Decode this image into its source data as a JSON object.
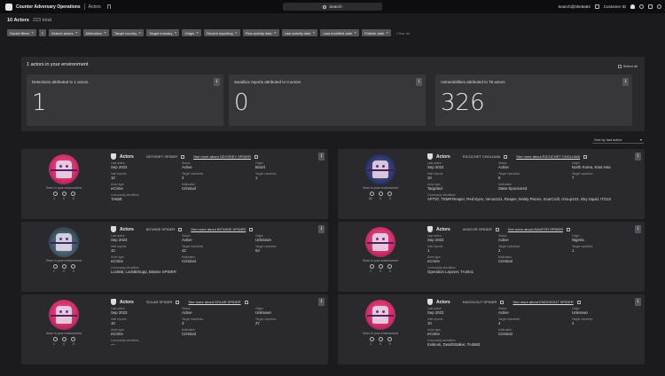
{
  "topbar": {
    "app_title": "Counter Adversary Operations",
    "breadcrumb": "Actors",
    "search_label": "Search",
    "user": "Search@00e9a84",
    "customer": "Customer ID"
  },
  "summary": {
    "count": "10 Actors",
    "total": "223 total"
  },
  "filters": [
    {
      "label": "Saved filters",
      "caret": true
    },
    {
      "label": "Search actors",
      "caret": true
    },
    {
      "label": "Motivation",
      "caret": true
    },
    {
      "label": "Target country",
      "caret": true
    },
    {
      "label": "Target industry",
      "caret": true
    },
    {
      "label": "Origin",
      "caret": true
    },
    {
      "label": "Recent reporting",
      "caret": true
    },
    {
      "label": "First activity date",
      "caret": true
    },
    {
      "label": "Last activity date",
      "caret": true
    },
    {
      "label": "Last modified date",
      "caret": true
    },
    {
      "label": "Publish date",
      "caret": true
    }
  ],
  "clear_all": "Clear all",
  "environment": {
    "title": "1 actors in your environment",
    "select_all": "Select all",
    "stats": [
      {
        "title": "Detections attributed to 1 actors",
        "value": "1"
      },
      {
        "title": "Sandbox reports attributed to 0 actors",
        "value": "0"
      },
      {
        "title": "Vulnerabilities attributed to 78 actors",
        "value": "326"
      }
    ]
  },
  "sort": {
    "label": "Sort by last active"
  },
  "labels": {
    "actors": "Actors",
    "seen": "Seen in your environment",
    "last_active": "Last active",
    "status": "Status",
    "origin": "Origin",
    "intel_reports": "Intel reports",
    "target_industries": "Target industries",
    "target_countries": "Target countries",
    "actor_type": "Actor type",
    "motivation": "Motivation",
    "community_identifiers": "Community identifiers"
  },
  "cards": [
    {
      "name": "ODYSSEY SPIDER",
      "see_more": "See more about ODYSSEY SPIDER",
      "avatar": "spider",
      "seen": [
        "1",
        "0",
        "0"
      ],
      "last_active": "Sep 2023",
      "status": "Active",
      "origin": "Brazil",
      "intel_reports": "10",
      "target_industries": "2",
      "target_countries": "1",
      "actor_type": "eCrime",
      "motivation": "Criminal",
      "community": "TA558"
    },
    {
      "name": "RICOCHET CHOLLIMA",
      "see_more": "See more about RICOCHET CHOLLIMA",
      "avatar": "dragon",
      "seen": [
        "82",
        "0",
        "0"
      ],
      "last_active": "Sep 2023",
      "status": "Active",
      "origin": "North Korea, East Asia",
      "intel_reports": "10",
      "target_industries": "6",
      "target_countries": "7",
      "actor_type": "Targeted",
      "motivation": "State-Sponsored",
      "community": "APT37, TEMP.Reaper, Red Eyes, Venus121, Reaper, Moldy Pisces, ScarCruft, Group123, Inky Squid, ITG10"
    },
    {
      "name": "BITWISE SPIDER",
      "see_more": "See more about BITWISE SPIDER",
      "avatar": "robot",
      "seen": [
        "1",
        "0",
        "0"
      ],
      "last_active": "Sep 2023",
      "status": "Active",
      "origin": "Unknown",
      "intel_reports": "10",
      "target_industries": "42",
      "target_countries": "63",
      "actor_type": "eCrime",
      "motivation": "Criminal",
      "community": "LockBit, LockBitSupp, Bitwise SPIDER"
    },
    {
      "name": "AVIATOR SPIDER",
      "see_more": "See more about AVIATOR SPIDER",
      "avatar": "spider",
      "seen": [
        "1",
        "0",
        "0"
      ],
      "last_active": "Sep 2023",
      "status": "Active",
      "origin": "Nigeria",
      "intel_reports": "1",
      "target_industries": "2",
      "target_countries": "1",
      "actor_type": "eCrime",
      "motivation": "Criminal",
      "community": "Operation Layover, TA2541"
    },
    {
      "name": "SOLAR SPIDER",
      "see_more": "See more about SOLAR SPIDER",
      "avatar": "spider",
      "seen": [
        "1",
        "0",
        "0"
      ],
      "last_active": "Sep 2023",
      "status": "Active",
      "origin": "Unknown",
      "intel_reports": "10",
      "target_industries": "3",
      "target_countries": "27",
      "actor_type": "eCrime",
      "motivation": "Criminal",
      "community": "—"
    },
    {
      "name": "KNOCKOUT SPIDER",
      "see_more": "See more about KNOCKOUT SPIDER",
      "avatar": "spider",
      "seen": [
        "1",
        "0",
        "0"
      ],
      "last_active": "Sep 2023",
      "status": "Active",
      "origin": "Unknown",
      "intel_reports": "10",
      "target_industries": "4",
      "target_countries": "4",
      "actor_type": "eCrime",
      "motivation": "Criminal",
      "community": "Evilnum, DeathStalker, TA4563"
    }
  ]
}
